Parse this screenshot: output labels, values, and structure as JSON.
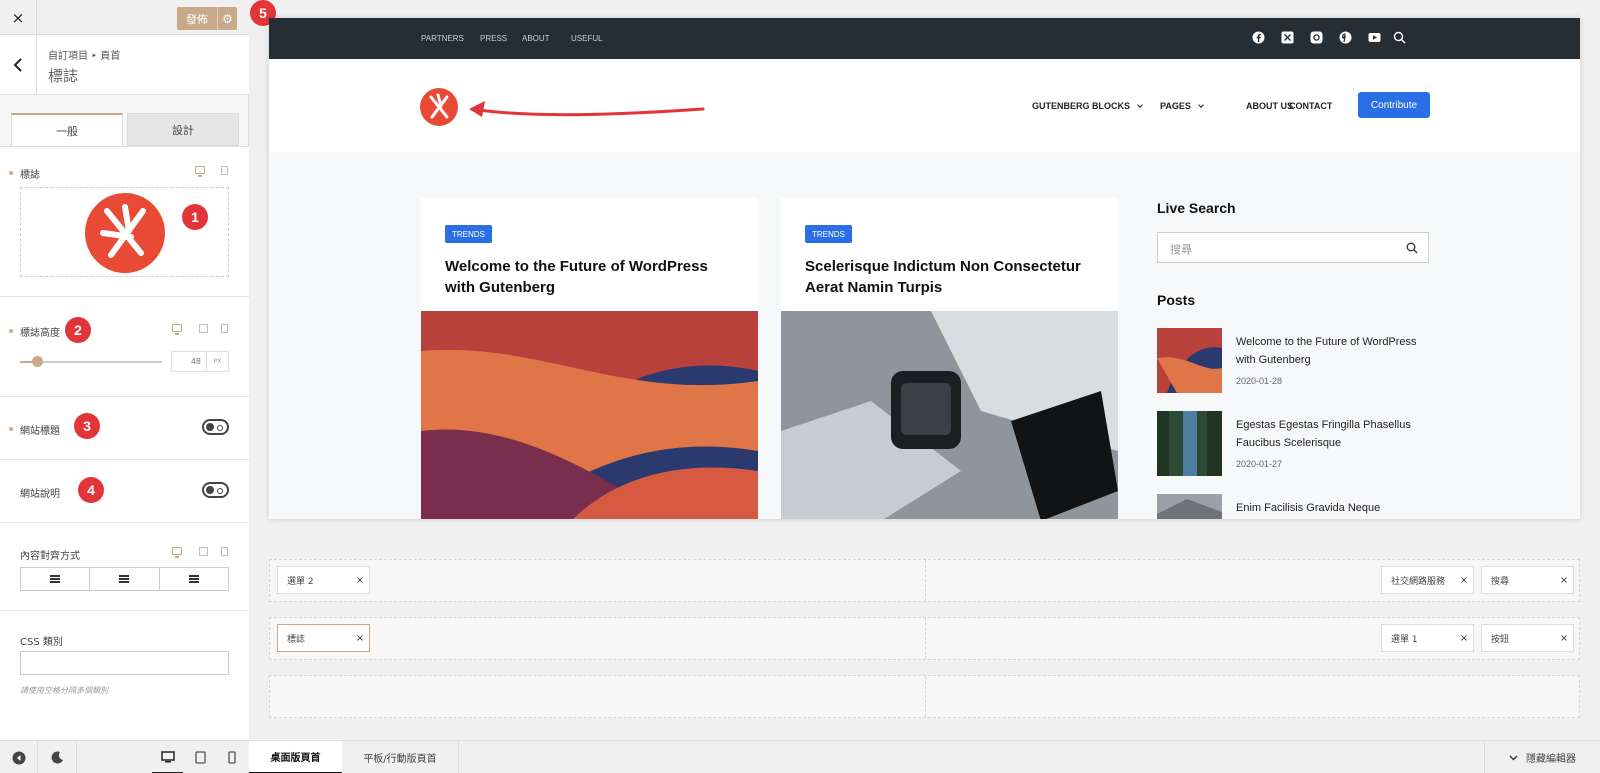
{
  "toolbar": {
    "close_label": "×",
    "publish_label": "發佈"
  },
  "breadcrumb": {
    "path": "自訂項目 ‣ 頁首",
    "title": "標誌"
  },
  "tabs": [
    {
      "label": "一般"
    },
    {
      "label": "設計"
    }
  ],
  "controls": {
    "logo_label": "標誌",
    "logo_height_label": "標誌高度",
    "logo_height_value": "48",
    "logo_height_unit": "PX",
    "logo_height_fraction": 0.12,
    "site_title_label": "網站標題",
    "site_title_on": false,
    "site_desc_label": "網站說明",
    "site_desc_on": false,
    "align_label": "內容對齊方式",
    "css_label": "CSS 類別",
    "css_hint": "請使用空格分隔多個類別"
  },
  "markers": [
    "1",
    "2",
    "3",
    "4",
    "5"
  ],
  "preview": {
    "top_links": [
      "PARTNERS",
      "PRESS",
      "ABOUT",
      "USEFUL"
    ],
    "social_icons": [
      "facebook-icon",
      "x-icon",
      "instagram-icon",
      "pinterest-icon",
      "youtube-icon",
      "search-icon"
    ],
    "nav": [
      "GUTENBERG BLOCKS",
      "PAGES",
      "ABOUT US",
      "CONTACT"
    ],
    "cta": "Contribute",
    "cards": [
      {
        "badge": "TRENDS",
        "title": "Welcome to the Future of WordPress with Gutenberg"
      },
      {
        "badge": "TRENDS",
        "title": "Scelerisque Indictum Non Consectetur Aerat Namin Turpis"
      }
    ],
    "sidebar": {
      "live_search": "Live Search",
      "search_placeholder": "搜尋",
      "posts_heading": "Posts",
      "posts": [
        {
          "title": "Welcome to the Future of WordPress with Gutenberg",
          "date": "2020-01-28"
        },
        {
          "title": "Egestas Egestas Fringilla Phasellus Faucibus Scelerisque",
          "date": "2020-01-27"
        },
        {
          "title": "Enim Facilisis Gravida Neque",
          "date": ""
        }
      ]
    }
  },
  "builder": {
    "row1": {
      "left": [
        "選單 2"
      ],
      "right": [
        "社交網路服務",
        "搜尋"
      ]
    },
    "row2": {
      "left": [
        "標誌"
      ],
      "right": [
        "選單 1",
        "按鈕"
      ]
    }
  },
  "bottom_tabs": {
    "desktop": "桌面版頁首",
    "mobile": "平板/行動版頁首",
    "hide": "隱藏編輯器"
  }
}
